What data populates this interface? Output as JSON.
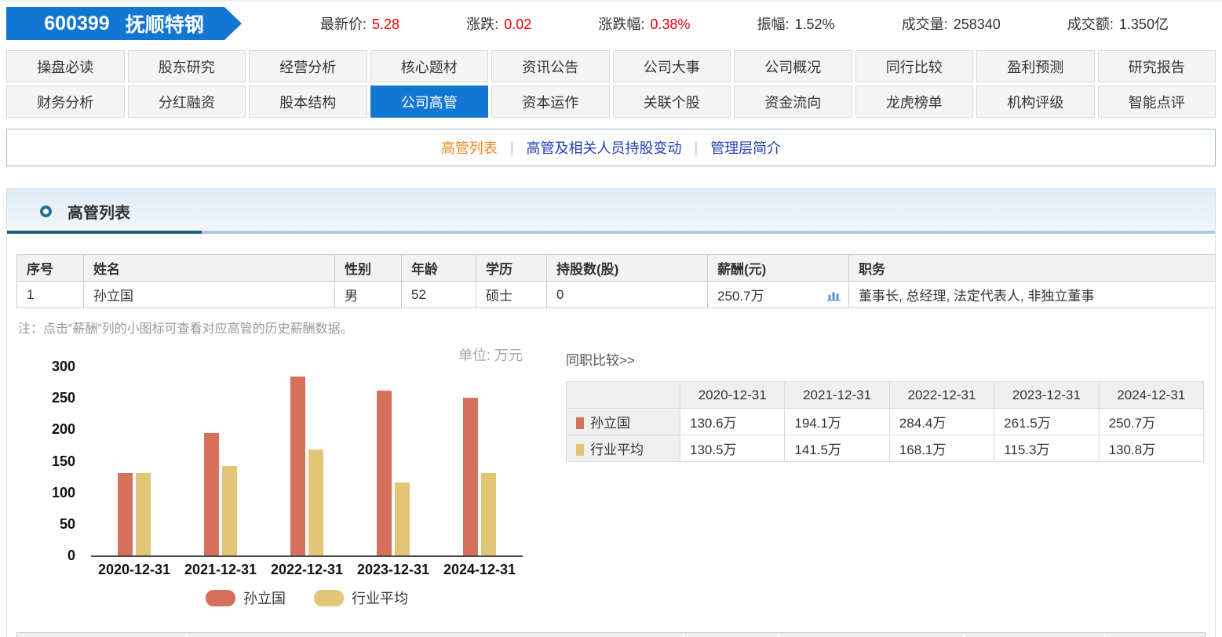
{
  "header": {
    "stock_code": "600399",
    "stock_name": "抚顺特钢",
    "stats": [
      {
        "label": "最新价:",
        "value": "5.28",
        "highlight": true
      },
      {
        "label": "涨跌:",
        "value": "0.02",
        "highlight": true
      },
      {
        "label": "涨跌幅:",
        "value": "0.38%",
        "highlight": true
      },
      {
        "label": "振幅:",
        "value": "1.52%",
        "highlight": false
      },
      {
        "label": "成交量:",
        "value": "258340",
        "highlight": false
      },
      {
        "label": "成交额:",
        "value": "1.350亿",
        "highlight": false
      }
    ]
  },
  "nav": {
    "row1": [
      "操盘必读",
      "股东研究",
      "经营分析",
      "核心题材",
      "资讯公告",
      "公司大事",
      "公司概况",
      "同行比较",
      "盈利预测",
      "研究报告"
    ],
    "row2": [
      "财务分析",
      "分红融资",
      "股本结构",
      "公司高管",
      "资本运作",
      "关联个股",
      "资金流向",
      "龙虎榜单",
      "机构评级",
      "智能点评"
    ],
    "active": "公司高管"
  },
  "subnav": {
    "items": [
      "高管列表",
      "高管及相关人员持股变动",
      "管理层简介"
    ],
    "active": "高管列表",
    "divider": "|"
  },
  "section": {
    "title": "高管列表"
  },
  "exec_table": {
    "headers": [
      "序号",
      "姓名",
      "性别",
      "年龄",
      "学历",
      "持股数(股)",
      "薪酬(元)",
      "职务"
    ],
    "rows": [
      [
        "1",
        "孙立国",
        "男",
        "52",
        "硕士",
        "0",
        "250.7万",
        "董事长, 总经理, 法定代表人, 非独立董事"
      ]
    ],
    "salary_column_index": 6
  },
  "note": "注：点击“薪酬”列的小图标可查看对应高管的历史薪酬数据。",
  "chart_data": {
    "type": "bar",
    "title": "",
    "unit_label": "单位: 万元",
    "categories": [
      "2020-12-31",
      "2021-12-31",
      "2022-12-31",
      "2023-12-31",
      "2024-12-31"
    ],
    "series": [
      {
        "name": "孙立国",
        "color": "#d5705a",
        "values": [
          130.6,
          194.1,
          284.4,
          261.5,
          250.7
        ]
      },
      {
        "name": "行业平均",
        "color": "#e2c577",
        "values": [
          130.5,
          141.5,
          168.1,
          115.3,
          130.8
        ]
      }
    ],
    "ylim": [
      0,
      300
    ],
    "yticks": [
      0,
      50,
      100,
      150,
      200,
      250,
      300
    ],
    "grid": false,
    "legend_position": "bottom"
  },
  "compare": {
    "title": "同职比较>>",
    "columns": [
      "2020-12-31",
      "2021-12-31",
      "2022-12-31",
      "2023-12-31",
      "2024-12-31"
    ],
    "rows": [
      {
        "name": "孙立国",
        "color": "#d5705a",
        "values": [
          "130.6万",
          "194.1万",
          "284.4万",
          "261.5万",
          "250.7万"
        ]
      },
      {
        "name": "行业平均",
        "color": "#e2c577",
        "values": [
          "130.5万",
          "141.5万",
          "168.1万",
          "115.3万",
          "130.8万"
        ]
      }
    ]
  },
  "icons": {
    "salary_history_icon": "bar-chart-icon",
    "section_bullet": "ring-icon"
  },
  "colors": {
    "brand_blue": "#1277d3",
    "highlight_red": "#ee0000",
    "subnav_active_orange": "#f5841f",
    "subnav_link_blue": "#2340b5",
    "header_underline_dark": "#1d5c7f",
    "header_underline_light": "#aecbde"
  }
}
